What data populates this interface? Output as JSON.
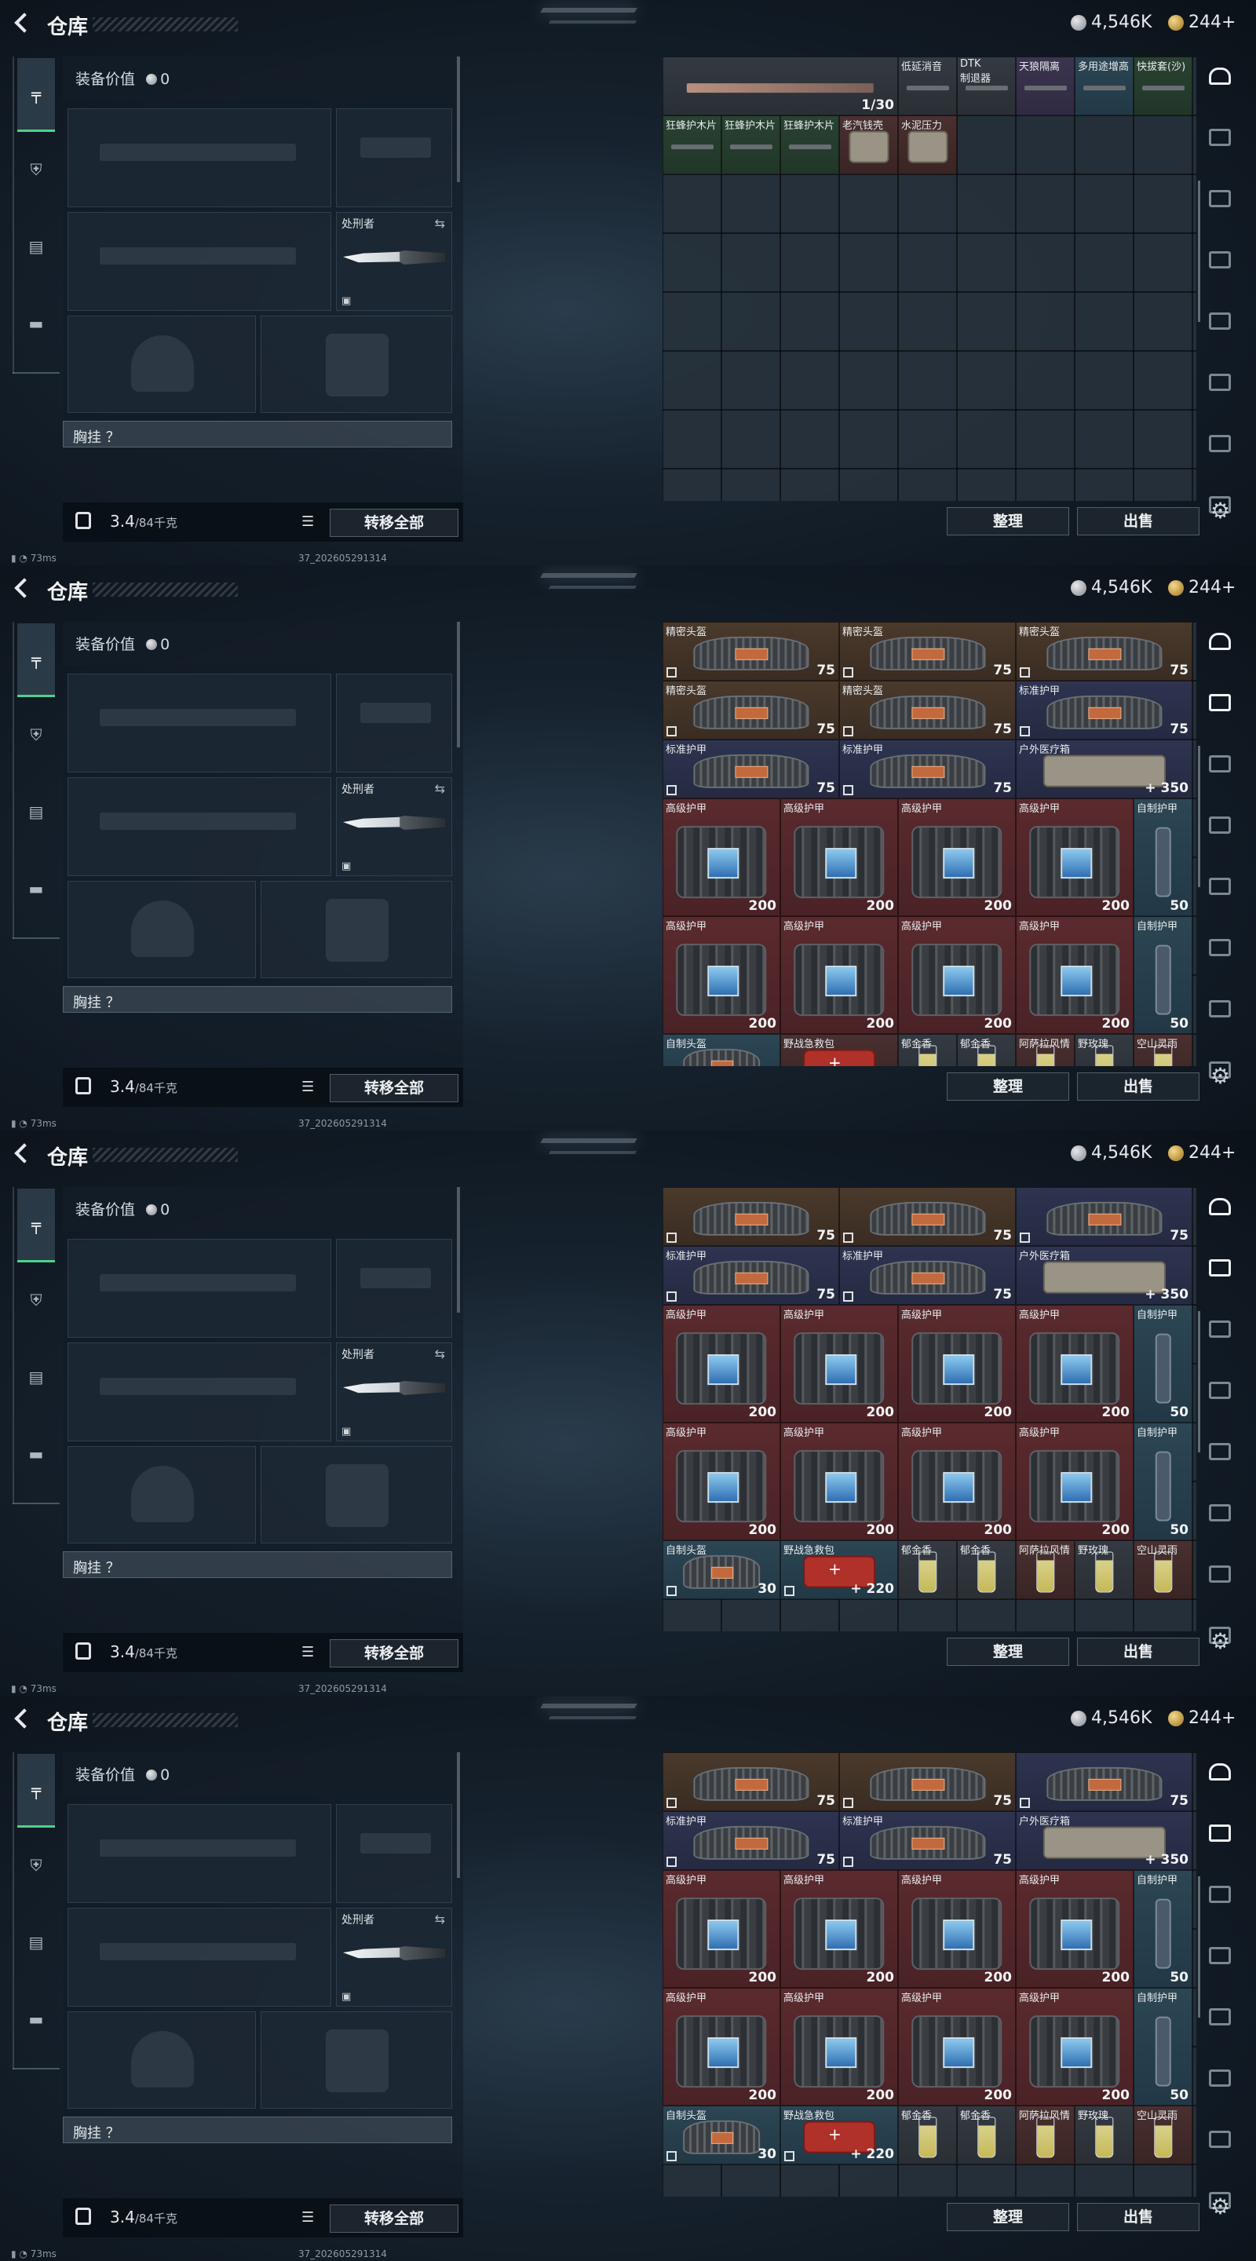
{
  "header": {
    "title": "仓库",
    "silver": "4,546K",
    "gold": "244+"
  },
  "loadout": {
    "equip_value_label": "装备价值",
    "equip_value": "0",
    "melee_name": "处刑者",
    "chest_label": "胸挂 ？",
    "weight_value": "3.4",
    "weight_max": "/84千克",
    "transfer_all": "转移全部"
  },
  "status": {
    "ping": "73ms",
    "version": "37_202605291314"
  },
  "stash_buttons": {
    "sort": "整理",
    "sell": "出售"
  },
  "stash_frames": [
    {
      "cells": [
        {
          "c": 0,
          "r": 0,
          "w": 4,
          "h": 1,
          "name": "",
          "value": "1/30",
          "tint": "dark",
          "art": "gun"
        },
        {
          "c": 4,
          "r": 0,
          "w": 1,
          "h": 1,
          "name": "低延消音",
          "value": "",
          "tint": "dark",
          "art": "strip"
        },
        {
          "c": 5,
          "r": 0,
          "w": 1,
          "h": 1,
          "name": "DTK\n制退器",
          "value": "",
          "tint": "dark",
          "art": "strip"
        },
        {
          "c": 6,
          "r": 0,
          "w": 1,
          "h": 1,
          "name": "天狼隔离",
          "value": "",
          "tint": "purple",
          "art": "strip"
        },
        {
          "c": 7,
          "r": 0,
          "w": 1,
          "h": 1,
          "name": "多用途增高",
          "value": "",
          "tint": "teal",
          "art": "strip"
        },
        {
          "c": 8,
          "r": 0,
          "w": 1,
          "h": 1,
          "name": "快拔套(沙)",
          "value": "",
          "tint": "green",
          "art": "strip"
        },
        {
          "c": 0,
          "r": 1,
          "w": 1,
          "h": 1,
          "name": "狂蜂护木片",
          "value": "",
          "tint": "green",
          "art": "strip"
        },
        {
          "c": 1,
          "r": 1,
          "w": 1,
          "h": 1,
          "name": "狂蜂护木片",
          "value": "",
          "tint": "green",
          "art": "strip"
        },
        {
          "c": 2,
          "r": 1,
          "w": 1,
          "h": 1,
          "name": "狂蜂护木片",
          "value": "",
          "tint": "green",
          "art": "strip"
        },
        {
          "c": 3,
          "r": 1,
          "w": 1,
          "h": 1,
          "name": "老汽钱壳",
          "value": "",
          "tint": "darkred",
          "art": "medkit"
        },
        {
          "c": 4,
          "r": 1,
          "w": 1,
          "h": 1,
          "name": "水泥压力",
          "value": "",
          "tint": "darkred",
          "art": "medkit"
        }
      ]
    },
    {
      "cells": [
        {
          "c": 0,
          "r": 0,
          "w": 3,
          "h": 1,
          "name": "精密头盔",
          "value": "75",
          "tint": "brown",
          "art": "helm"
        },
        {
          "c": 3,
          "r": 0,
          "w": 3,
          "h": 1,
          "name": "精密头盔",
          "value": "75",
          "tint": "brown",
          "art": "helm"
        },
        {
          "c": 6,
          "r": 0,
          "w": 3,
          "h": 1,
          "name": "精密头盔",
          "value": "75",
          "tint": "brown",
          "art": "helm"
        },
        {
          "c": 0,
          "r": 1,
          "w": 3,
          "h": 1,
          "name": "精密头盔",
          "value": "75",
          "tint": "brown",
          "art": "helm"
        },
        {
          "c": 3,
          "r": 1,
          "w": 3,
          "h": 1,
          "name": "精密头盔",
          "value": "75",
          "tint": "brown",
          "art": "helm"
        },
        {
          "c": 6,
          "r": 1,
          "w": 3,
          "h": 1,
          "name": "标准护甲",
          "value": "75",
          "tint": "navy",
          "art": "helm"
        },
        {
          "c": 0,
          "r": 2,
          "w": 3,
          "h": 1,
          "name": "标准护甲",
          "value": "75",
          "tint": "navy",
          "art": "helm"
        },
        {
          "c": 3,
          "r": 2,
          "w": 3,
          "h": 1,
          "name": "标准护甲",
          "value": "75",
          "tint": "navy",
          "art": "helm"
        },
        {
          "c": 6,
          "r": 2,
          "w": 3,
          "h": 1,
          "name": "户外医疗箱",
          "value": "+ 350",
          "tint": "navy",
          "art": "medkit"
        },
        {
          "c": 0,
          "r": 3,
          "w": 2,
          "h": 2,
          "name": "高级护甲",
          "value": "200",
          "tint": "red",
          "art": "vest"
        },
        {
          "c": 2,
          "r": 3,
          "w": 2,
          "h": 2,
          "name": "高级护甲",
          "value": "200",
          "tint": "red",
          "art": "vest"
        },
        {
          "c": 4,
          "r": 3,
          "w": 2,
          "h": 2,
          "name": "高级护甲",
          "value": "200",
          "tint": "red",
          "art": "vest"
        },
        {
          "c": 6,
          "r": 3,
          "w": 2,
          "h": 2,
          "name": "高级护甲",
          "value": "200",
          "tint": "red",
          "art": "vest"
        },
        {
          "c": 8,
          "r": 3,
          "w": 1,
          "h": 2,
          "name": "自制护甲",
          "value": "50",
          "tint": "teal",
          "art": "plate"
        },
        {
          "c": 0,
          "r": 5,
          "w": 2,
          "h": 2,
          "name": "高级护甲",
          "value": "200",
          "tint": "red",
          "art": "vest"
        },
        {
          "c": 2,
          "r": 5,
          "w": 2,
          "h": 2,
          "name": "高级护甲",
          "value": "200",
          "tint": "red",
          "art": "vest"
        },
        {
          "c": 4,
          "r": 5,
          "w": 2,
          "h": 2,
          "name": "高级护甲",
          "value": "200",
          "tint": "red",
          "art": "vest"
        },
        {
          "c": 6,
          "r": 5,
          "w": 2,
          "h": 2,
          "name": "高级护甲",
          "value": "200",
          "tint": "red",
          "art": "vest"
        },
        {
          "c": 8,
          "r": 5,
          "w": 1,
          "h": 2,
          "name": "自制护甲",
          "value": "50",
          "tint": "teal",
          "art": "plate"
        },
        {
          "c": 0,
          "r": 7,
          "w": 2,
          "h": 1,
          "name": "自制头盔",
          "value": "",
          "tint": "teal",
          "art": "helm"
        },
        {
          "c": 2,
          "r": 7,
          "w": 2,
          "h": 1,
          "name": "野战急救包",
          "value": "",
          "tint": "darkred",
          "art": "redkit"
        },
        {
          "c": 4,
          "r": 7,
          "w": 1,
          "h": 1,
          "name": "郁金香",
          "value": "",
          "tint": "dark",
          "art": "drink"
        },
        {
          "c": 5,
          "r": 7,
          "w": 1,
          "h": 1,
          "name": "郁金香",
          "value": "",
          "tint": "dark",
          "art": "drink"
        },
        {
          "c": 6,
          "r": 7,
          "w": 1,
          "h": 1,
          "name": "阿萨拉风情",
          "value": "",
          "tint": "darkred",
          "art": "drink"
        },
        {
          "c": 7,
          "r": 7,
          "w": 1,
          "h": 1,
          "name": "野玫瑰",
          "value": "",
          "tint": "dark",
          "art": "drink"
        },
        {
          "c": 8,
          "r": 7,
          "w": 1,
          "h": 1,
          "name": "空山灵雨",
          "value": "",
          "tint": "darkred",
          "art": "drink"
        }
      ]
    },
    {
      "cells": [
        {
          "c": 0,
          "r": 0,
          "w": 3,
          "h": 1,
          "name": "",
          "value": "75",
          "tint": "brown",
          "art": "helm"
        },
        {
          "c": 3,
          "r": 0,
          "w": 3,
          "h": 1,
          "name": "",
          "value": "75",
          "tint": "brown",
          "art": "helm"
        },
        {
          "c": 6,
          "r": 0,
          "w": 3,
          "h": 1,
          "name": "",
          "value": "75",
          "tint": "navy",
          "art": "helm"
        },
        {
          "c": 0,
          "r": 1,
          "w": 3,
          "h": 1,
          "name": "标准护甲",
          "value": "75",
          "tint": "navy",
          "art": "helm"
        },
        {
          "c": 3,
          "r": 1,
          "w": 3,
          "h": 1,
          "name": "标准护甲",
          "value": "75",
          "tint": "navy",
          "art": "helm"
        },
        {
          "c": 6,
          "r": 1,
          "w": 3,
          "h": 1,
          "name": "户外医疗箱",
          "value": "+ 350",
          "tint": "navy",
          "art": "medkit"
        },
        {
          "c": 0,
          "r": 2,
          "w": 2,
          "h": 2,
          "name": "高级护甲",
          "value": "200",
          "tint": "red",
          "art": "vest"
        },
        {
          "c": 2,
          "r": 2,
          "w": 2,
          "h": 2,
          "name": "高级护甲",
          "value": "200",
          "tint": "red",
          "art": "vest"
        },
        {
          "c": 4,
          "r": 2,
          "w": 2,
          "h": 2,
          "name": "高级护甲",
          "value": "200",
          "tint": "red",
          "art": "vest"
        },
        {
          "c": 6,
          "r": 2,
          "w": 2,
          "h": 2,
          "name": "高级护甲",
          "value": "200",
          "tint": "red",
          "art": "vest"
        },
        {
          "c": 8,
          "r": 2,
          "w": 1,
          "h": 2,
          "name": "自制护甲",
          "value": "50",
          "tint": "teal",
          "art": "plate"
        },
        {
          "c": 0,
          "r": 4,
          "w": 2,
          "h": 2,
          "name": "高级护甲",
          "value": "200",
          "tint": "red",
          "art": "vest"
        },
        {
          "c": 2,
          "r": 4,
          "w": 2,
          "h": 2,
          "name": "高级护甲",
          "value": "200",
          "tint": "red",
          "art": "vest"
        },
        {
          "c": 4,
          "r": 4,
          "w": 2,
          "h": 2,
          "name": "高级护甲",
          "value": "200",
          "tint": "red",
          "art": "vest"
        },
        {
          "c": 6,
          "r": 4,
          "w": 2,
          "h": 2,
          "name": "高级护甲",
          "value": "200",
          "tint": "red",
          "art": "vest"
        },
        {
          "c": 8,
          "r": 4,
          "w": 1,
          "h": 2,
          "name": "自制护甲",
          "value": "50",
          "tint": "teal",
          "art": "plate"
        },
        {
          "c": 0,
          "r": 6,
          "w": 2,
          "h": 1,
          "name": "自制头盔",
          "value": "30",
          "tint": "teal",
          "art": "helm"
        },
        {
          "c": 2,
          "r": 6,
          "w": 2,
          "h": 1,
          "name": "野战急救包",
          "value": "+ 220",
          "tint": "teal",
          "art": "redkit"
        },
        {
          "c": 4,
          "r": 6,
          "w": 1,
          "h": 1,
          "name": "郁金香",
          "value": "",
          "tint": "dark",
          "art": "drink"
        },
        {
          "c": 5,
          "r": 6,
          "w": 1,
          "h": 1,
          "name": "郁金香",
          "value": "",
          "tint": "dark",
          "art": "drink"
        },
        {
          "c": 6,
          "r": 6,
          "w": 1,
          "h": 1,
          "name": "阿萨拉风情",
          "value": "",
          "tint": "darkred",
          "art": "drink"
        },
        {
          "c": 7,
          "r": 6,
          "w": 1,
          "h": 1,
          "name": "野玫瑰",
          "value": "",
          "tint": "dark",
          "art": "drink"
        },
        {
          "c": 8,
          "r": 6,
          "w": 1,
          "h": 1,
          "name": "空山灵雨",
          "value": "",
          "tint": "darkred",
          "art": "drink"
        }
      ]
    },
    {
      "cells": [
        {
          "c": 0,
          "r": 0,
          "w": 3,
          "h": 1,
          "name": "",
          "value": "75",
          "tint": "brown",
          "art": "helm"
        },
        {
          "c": 3,
          "r": 0,
          "w": 3,
          "h": 1,
          "name": "",
          "value": "75",
          "tint": "brown",
          "art": "helm"
        },
        {
          "c": 6,
          "r": 0,
          "w": 3,
          "h": 1,
          "name": "",
          "value": "75",
          "tint": "navy",
          "art": "helm"
        },
        {
          "c": 0,
          "r": 1,
          "w": 3,
          "h": 1,
          "name": "标准护甲",
          "value": "75",
          "tint": "navy",
          "art": "helm"
        },
        {
          "c": 3,
          "r": 1,
          "w": 3,
          "h": 1,
          "name": "标准护甲",
          "value": "75",
          "tint": "navy",
          "art": "helm"
        },
        {
          "c": 6,
          "r": 1,
          "w": 3,
          "h": 1,
          "name": "户外医疗箱",
          "value": "+ 350",
          "tint": "navy",
          "art": "medkit"
        },
        {
          "c": 0,
          "r": 2,
          "w": 2,
          "h": 2,
          "name": "高级护甲",
          "value": "200",
          "tint": "red",
          "art": "vest"
        },
        {
          "c": 2,
          "r": 2,
          "w": 2,
          "h": 2,
          "name": "高级护甲",
          "value": "200",
          "tint": "red",
          "art": "vest"
        },
        {
          "c": 4,
          "r": 2,
          "w": 2,
          "h": 2,
          "name": "高级护甲",
          "value": "200",
          "tint": "red",
          "art": "vest"
        },
        {
          "c": 6,
          "r": 2,
          "w": 2,
          "h": 2,
          "name": "高级护甲",
          "value": "200",
          "tint": "red",
          "art": "vest"
        },
        {
          "c": 8,
          "r": 2,
          "w": 1,
          "h": 2,
          "name": "自制护甲",
          "value": "50",
          "tint": "teal",
          "art": "plate"
        },
        {
          "c": 0,
          "r": 4,
          "w": 2,
          "h": 2,
          "name": "高级护甲",
          "value": "200",
          "tint": "red",
          "art": "vest"
        },
        {
          "c": 2,
          "r": 4,
          "w": 2,
          "h": 2,
          "name": "高级护甲",
          "value": "200",
          "tint": "red",
          "art": "vest"
        },
        {
          "c": 4,
          "r": 4,
          "w": 2,
          "h": 2,
          "name": "高级护甲",
          "value": "200",
          "tint": "red",
          "art": "vest"
        },
        {
          "c": 6,
          "r": 4,
          "w": 2,
          "h": 2,
          "name": "高级护甲",
          "value": "200",
          "tint": "red",
          "art": "vest"
        },
        {
          "c": 8,
          "r": 4,
          "w": 1,
          "h": 2,
          "name": "自制护甲",
          "value": "50",
          "tint": "teal",
          "art": "plate"
        },
        {
          "c": 0,
          "r": 6,
          "w": 2,
          "h": 1,
          "name": "自制头盔",
          "value": "30",
          "tint": "teal",
          "art": "helm"
        },
        {
          "c": 2,
          "r": 6,
          "w": 2,
          "h": 1,
          "name": "野战急救包",
          "value": "+ 220",
          "tint": "teal",
          "art": "redkit"
        },
        {
          "c": 4,
          "r": 6,
          "w": 1,
          "h": 1,
          "name": "郁金香",
          "value": "",
          "tint": "dark",
          "art": "drink"
        },
        {
          "c": 5,
          "r": 6,
          "w": 1,
          "h": 1,
          "name": "郁金香",
          "value": "",
          "tint": "dark",
          "art": "drink"
        },
        {
          "c": 6,
          "r": 6,
          "w": 1,
          "h": 1,
          "name": "阿萨拉风情",
          "value": "",
          "tint": "darkred",
          "art": "drink"
        },
        {
          "c": 7,
          "r": 6,
          "w": 1,
          "h": 1,
          "name": "野玫瑰",
          "value": "",
          "tint": "dark",
          "art": "drink"
        },
        {
          "c": 8,
          "r": 6,
          "w": 1,
          "h": 1,
          "name": "空山灵雨",
          "value": "",
          "tint": "darkred",
          "art": "drink"
        }
      ]
    }
  ]
}
